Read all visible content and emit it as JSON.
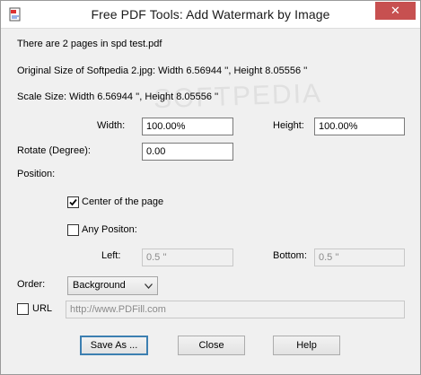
{
  "window": {
    "title": "Free PDF Tools: Add Watermark by Image",
    "close_symbol": "✕"
  },
  "info": {
    "pages": "There are 2 pages in spd test.pdf",
    "original_size": "Original Size of Softpedia 2.jpg:  Width 6.56944 '',   Height 8.05556 ''",
    "scale_size": "Scale Size:  Width 6.56944 '',   Height 8.05556 ''"
  },
  "size": {
    "width_label": "Width:",
    "width_value": "100.00%",
    "height_label": "Height:",
    "height_value": "100.00%"
  },
  "rotate": {
    "label": "Rotate (Degree):",
    "value": "0.00"
  },
  "position": {
    "label": "Position:",
    "center_label": "Center of the page",
    "center_checked": true,
    "any_label": "Any Positon:",
    "any_checked": false,
    "left_label": "Left:",
    "left_value": "0.5 ''",
    "bottom_label": "Bottom:",
    "bottom_value": "0.5 ''"
  },
  "order": {
    "label": "Order:",
    "selected": "Background"
  },
  "url": {
    "label": "URL",
    "checked": false,
    "value": "http://www.PDFill.com"
  },
  "buttons": {
    "save": "Save As ...",
    "close": "Close",
    "help": "Help"
  },
  "watermark_text": "SOFTPEDIA",
  "colors": {
    "close_button": "#c75050",
    "default_button_border": "#3c7fb1"
  }
}
